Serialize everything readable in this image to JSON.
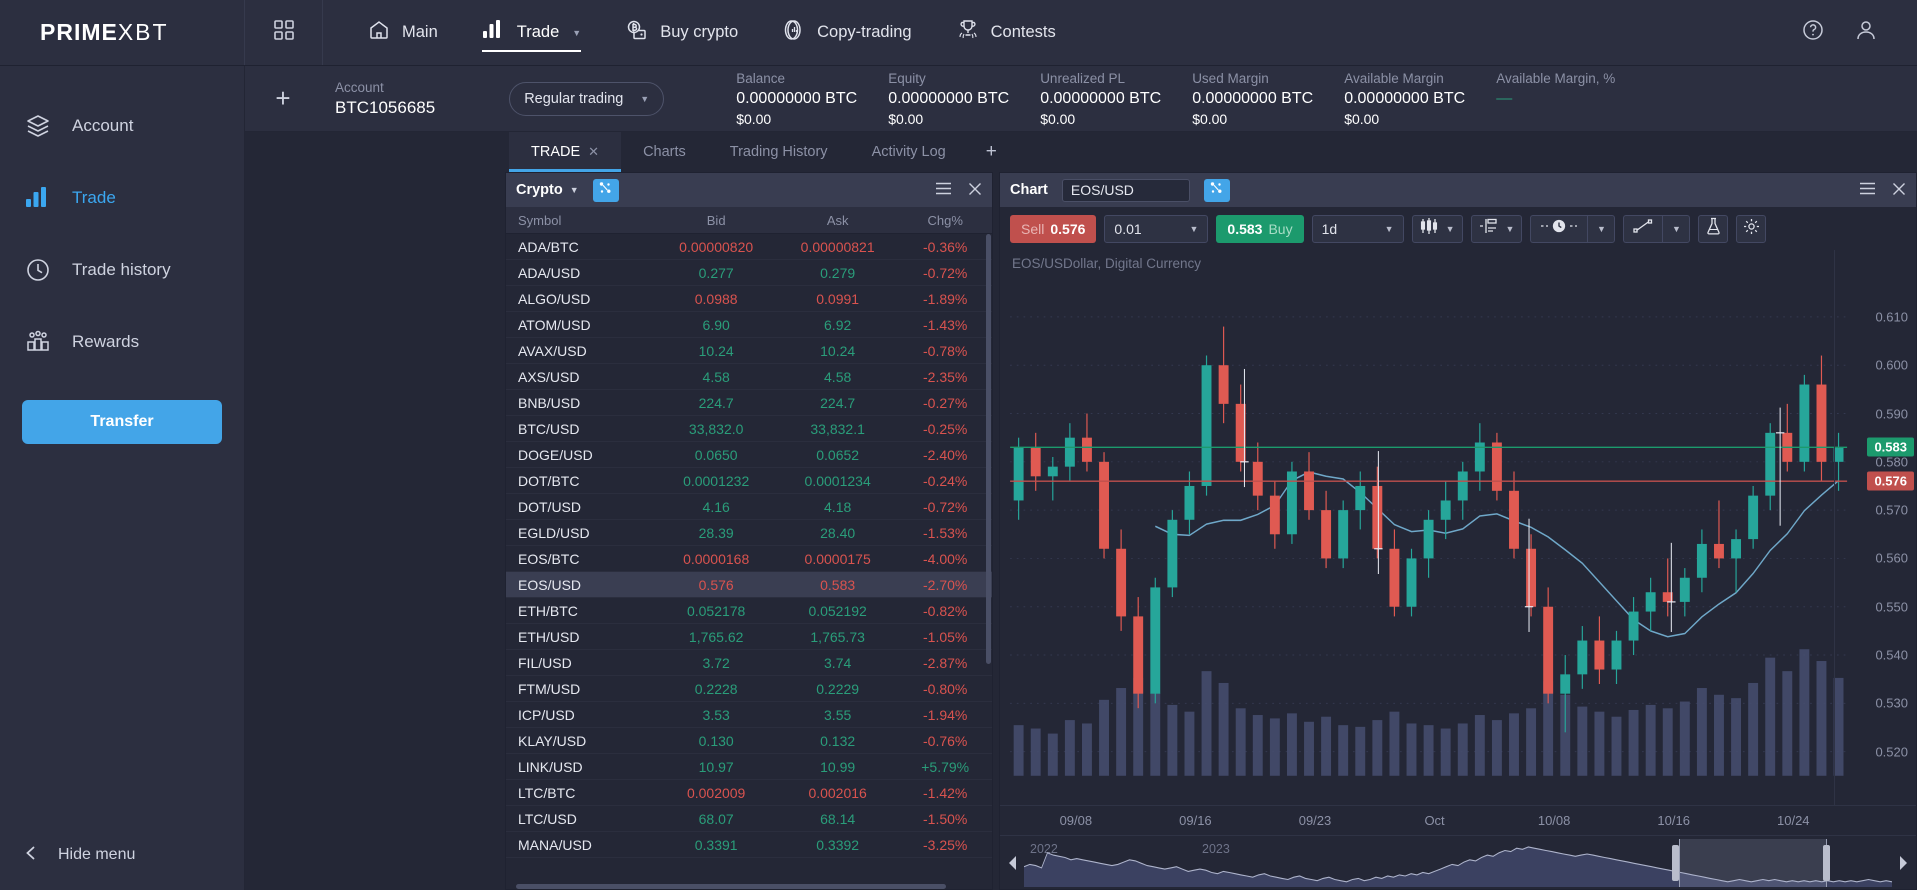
{
  "brand": {
    "prime": "PRIME",
    "xbt": "XBT"
  },
  "topnav": {
    "grid_icon": "grid-icon",
    "items": [
      {
        "label": "Main",
        "icon": "home-icon",
        "active": false,
        "caret": false
      },
      {
        "label": "Trade",
        "icon": "bars-icon",
        "active": true,
        "caret": true
      },
      {
        "label": "Buy crypto",
        "icon": "wallet-bitcoin-icon",
        "active": false,
        "caret": false
      },
      {
        "label": "Copy-trading",
        "icon": "copy-trading-icon",
        "active": false,
        "caret": false
      },
      {
        "label": "Contests",
        "icon": "trophy-icon",
        "active": false,
        "caret": false
      }
    ],
    "help_icon": "question-circle-icon",
    "profile_icon": "user-icon"
  },
  "sidebar": {
    "items": [
      {
        "label": "Account",
        "icon": "layers-icon",
        "active": false
      },
      {
        "label": "Trade",
        "icon": "bar-chart-icon",
        "active": true
      },
      {
        "label": "Trade history",
        "icon": "clock-icon",
        "active": false
      },
      {
        "label": "Rewards",
        "icon": "people-icon",
        "active": false
      }
    ],
    "transfer_label": "Transfer",
    "hide_menu_label": "Hide menu",
    "hide_menu_icon": "chevron-left-icon"
  },
  "account_strip": {
    "add_icon": "plus-icon",
    "account_label": "Account",
    "account_value": "BTC1056685",
    "mode": "Regular trading",
    "stats": [
      {
        "label": "Balance",
        "value": "0.00000000 BTC",
        "sub": "$0.00"
      },
      {
        "label": "Equity",
        "value": "0.00000000 BTC",
        "sub": "$0.00"
      },
      {
        "label": "Unrealized PL",
        "value": "0.00000000 BTC",
        "sub": "$0.00"
      },
      {
        "label": "Used Margin",
        "value": "0.00000000 BTC",
        "sub": "$0.00"
      },
      {
        "label": "Available Margin",
        "value": "0.00000000 BTC",
        "sub": "$0.00"
      },
      {
        "label": "Available Margin, %",
        "value": "—",
        "sub": ""
      }
    ]
  },
  "tabs": {
    "items": [
      {
        "label": "TRADE",
        "active": true,
        "closable": true
      },
      {
        "label": "Charts",
        "active": false,
        "closable": false
      },
      {
        "label": "Trading History",
        "active": false,
        "closable": false
      },
      {
        "label": "Activity Log",
        "active": false,
        "closable": false
      }
    ],
    "add_label": "+"
  },
  "crypto_panel": {
    "title": "Crypto",
    "filter_icon": "assets-icon",
    "menu_icon": "hamburger-icon",
    "close_icon": "close-icon",
    "columns": [
      "Symbol",
      "Bid",
      "Ask",
      "Chg%"
    ],
    "rows": [
      {
        "symbol": "ADA/BTC",
        "bid": "0.00000820",
        "ask": "0.00000821",
        "chg": "-0.36%",
        "bid_dir": "down",
        "ask_dir": "down",
        "chg_dir": "down",
        "selected": false
      },
      {
        "symbol": "ADA/USD",
        "bid": "0.277",
        "ask": "0.279",
        "chg": "-0.72%",
        "bid_dir": "up",
        "ask_dir": "up",
        "chg_dir": "down",
        "selected": false
      },
      {
        "symbol": "ALGO/USD",
        "bid": "0.0988",
        "ask": "0.0991",
        "chg": "-1.89%",
        "bid_dir": "down",
        "ask_dir": "down",
        "chg_dir": "down",
        "selected": false
      },
      {
        "symbol": "ATOM/USD",
        "bid": "6.90",
        "ask": "6.92",
        "chg": "-1.43%",
        "bid_dir": "up",
        "ask_dir": "up",
        "chg_dir": "down",
        "selected": false
      },
      {
        "symbol": "AVAX/USD",
        "bid": "10.24",
        "ask": "10.24",
        "chg": "-0.78%",
        "bid_dir": "up",
        "ask_dir": "up",
        "chg_dir": "down",
        "selected": false
      },
      {
        "symbol": "AXS/USD",
        "bid": "4.58",
        "ask": "4.58",
        "chg": "-2.35%",
        "bid_dir": "up",
        "ask_dir": "up",
        "chg_dir": "down",
        "selected": false
      },
      {
        "symbol": "BNB/USD",
        "bid": "224.7",
        "ask": "224.7",
        "chg": "-0.27%",
        "bid_dir": "up",
        "ask_dir": "up",
        "chg_dir": "down",
        "selected": false
      },
      {
        "symbol": "BTC/USD",
        "bid": "33,832.0",
        "ask": "33,832.1",
        "chg": "-0.25%",
        "bid_dir": "up",
        "ask_dir": "up",
        "chg_dir": "down",
        "selected": false
      },
      {
        "symbol": "DOGE/USD",
        "bid": "0.0650",
        "ask": "0.0652",
        "chg": "-2.40%",
        "bid_dir": "up",
        "ask_dir": "up",
        "chg_dir": "down",
        "selected": false
      },
      {
        "symbol": "DOT/BTC",
        "bid": "0.0001232",
        "ask": "0.0001234",
        "chg": "-0.24%",
        "bid_dir": "up",
        "ask_dir": "up",
        "chg_dir": "down",
        "selected": false
      },
      {
        "symbol": "DOT/USD",
        "bid": "4.16",
        "ask": "4.18",
        "chg": "-0.72%",
        "bid_dir": "up",
        "ask_dir": "up",
        "chg_dir": "down",
        "selected": false
      },
      {
        "symbol": "EGLD/USD",
        "bid": "28.39",
        "ask": "28.40",
        "chg": "-1.53%",
        "bid_dir": "up",
        "ask_dir": "up",
        "chg_dir": "down",
        "selected": false
      },
      {
        "symbol": "EOS/BTC",
        "bid": "0.0000168",
        "ask": "0.0000175",
        "chg": "-4.00%",
        "bid_dir": "down",
        "ask_dir": "down",
        "chg_dir": "down",
        "selected": false
      },
      {
        "symbol": "EOS/USD",
        "bid": "0.576",
        "ask": "0.583",
        "chg": "-2.70%",
        "bid_dir": "down",
        "ask_dir": "down",
        "chg_dir": "down",
        "selected": true
      },
      {
        "symbol": "ETH/BTC",
        "bid": "0.052178",
        "ask": "0.052192",
        "chg": "-0.82%",
        "bid_dir": "up",
        "ask_dir": "up",
        "chg_dir": "down",
        "selected": false
      },
      {
        "symbol": "ETH/USD",
        "bid": "1,765.62",
        "ask": "1,765.73",
        "chg": "-1.05%",
        "bid_dir": "up",
        "ask_dir": "up",
        "chg_dir": "down",
        "selected": false
      },
      {
        "symbol": "FIL/USD",
        "bid": "3.72",
        "ask": "3.74",
        "chg": "-2.87%",
        "bid_dir": "up",
        "ask_dir": "up",
        "chg_dir": "down",
        "selected": false
      },
      {
        "symbol": "FTM/USD",
        "bid": "0.2228",
        "ask": "0.2229",
        "chg": "-0.80%",
        "bid_dir": "up",
        "ask_dir": "up",
        "chg_dir": "down",
        "selected": false
      },
      {
        "symbol": "ICP/USD",
        "bid": "3.53",
        "ask": "3.55",
        "chg": "-1.94%",
        "bid_dir": "up",
        "ask_dir": "up",
        "chg_dir": "down",
        "selected": false
      },
      {
        "symbol": "KLAY/USD",
        "bid": "0.130",
        "ask": "0.132",
        "chg": "-0.76%",
        "bid_dir": "up",
        "ask_dir": "up",
        "chg_dir": "down",
        "selected": false
      },
      {
        "symbol": "LINK/USD",
        "bid": "10.97",
        "ask": "10.99",
        "chg": "+5.79%",
        "bid_dir": "up",
        "ask_dir": "up",
        "chg_dir": "up",
        "selected": false
      },
      {
        "symbol": "LTC/BTC",
        "bid": "0.002009",
        "ask": "0.002016",
        "chg": "-1.42%",
        "bid_dir": "down",
        "ask_dir": "down",
        "chg_dir": "down",
        "selected": false
      },
      {
        "symbol": "LTC/USD",
        "bid": "68.07",
        "ask": "68.14",
        "chg": "-1.50%",
        "bid_dir": "up",
        "ask_dir": "up",
        "chg_dir": "down",
        "selected": false
      },
      {
        "symbol": "MANA/USD",
        "bid": "0.3391",
        "ask": "0.3392",
        "chg": "-3.25%",
        "bid_dir": "up",
        "ask_dir": "up",
        "chg_dir": "down",
        "selected": false
      }
    ]
  },
  "chart_panel": {
    "title": "Chart",
    "symbol": "EOS/USD",
    "filter_icon": "assets-icon",
    "menu_icon": "hamburger-icon",
    "close_icon": "close-icon",
    "sell_label": "Sell",
    "sell_price": "0.576",
    "buy_label": "Buy",
    "buy_price": "0.583",
    "quantity": "0.01",
    "timeframe": "1d",
    "tool_candles_icon": "candlestick-icon",
    "tool_indicators_icon": "indicators-icon",
    "tool_clock_icon": "time-icon",
    "tool_line_icon": "trendline-icon",
    "tool_flask_icon": "flask-icon",
    "tool_gear_icon": "gear-icon",
    "subtitle": "EOS/USDollar, Digital Currency"
  },
  "chart_data": {
    "type": "candlestick",
    "title": "EOS/USDollar, Digital Currency",
    "symbol": "EOS/USD",
    "timeframe": "1d",
    "ylim": [
      0.515,
      0.617
    ],
    "yticks": [
      0.52,
      0.53,
      0.54,
      0.55,
      0.56,
      0.57,
      0.58,
      0.59,
      0.6,
      0.61
    ],
    "xticks": [
      "09/08",
      "09/16",
      "09/23",
      "Oct",
      "10/08",
      "10/16",
      "10/24"
    ],
    "grid": true,
    "legend": "none",
    "price_markers": [
      {
        "value": "0.583",
        "kind": "ask",
        "color": "#1c9a6d"
      },
      {
        "value": "0.576",
        "kind": "bid",
        "color": "#c0504d"
      }
    ],
    "overlays": [
      {
        "name": "moving-average",
        "color": "#6fa8c9"
      },
      {
        "name": "volume",
        "color": "#4a5272"
      }
    ],
    "candles": [
      {
        "o": 0.572,
        "h": 0.585,
        "l": 0.568,
        "c": 0.583,
        "v": 0.3
      },
      {
        "o": 0.583,
        "h": 0.586,
        "l": 0.574,
        "c": 0.577,
        "v": 0.28
      },
      {
        "o": 0.577,
        "h": 0.581,
        "l": 0.572,
        "c": 0.579,
        "v": 0.25
      },
      {
        "o": 0.579,
        "h": 0.588,
        "l": 0.576,
        "c": 0.585,
        "v": 0.33
      },
      {
        "o": 0.585,
        "h": 0.59,
        "l": 0.578,
        "c": 0.58,
        "v": 0.31
      },
      {
        "o": 0.58,
        "h": 0.582,
        "l": 0.56,
        "c": 0.562,
        "v": 0.45
      },
      {
        "o": 0.562,
        "h": 0.566,
        "l": 0.545,
        "c": 0.548,
        "v": 0.52
      },
      {
        "o": 0.548,
        "h": 0.552,
        "l": 0.529,
        "c": 0.532,
        "v": 0.58
      },
      {
        "o": 0.532,
        "h": 0.556,
        "l": 0.53,
        "c": 0.554,
        "v": 0.49
      },
      {
        "o": 0.554,
        "h": 0.57,
        "l": 0.552,
        "c": 0.568,
        "v": 0.42
      },
      {
        "o": 0.568,
        "h": 0.578,
        "l": 0.565,
        "c": 0.575,
        "v": 0.38
      },
      {
        "o": 0.575,
        "h": 0.602,
        "l": 0.573,
        "c": 0.6,
        "v": 0.62
      },
      {
        "o": 0.6,
        "h": 0.608,
        "l": 0.588,
        "c": 0.592,
        "v": 0.55
      },
      {
        "o": 0.592,
        "h": 0.596,
        "l": 0.578,
        "c": 0.58,
        "v": 0.4
      },
      {
        "o": 0.58,
        "h": 0.584,
        "l": 0.57,
        "c": 0.573,
        "v": 0.36
      },
      {
        "o": 0.573,
        "h": 0.576,
        "l": 0.562,
        "c": 0.565,
        "v": 0.34
      },
      {
        "o": 0.565,
        "h": 0.58,
        "l": 0.563,
        "c": 0.578,
        "v": 0.37
      },
      {
        "o": 0.578,
        "h": 0.582,
        "l": 0.568,
        "c": 0.57,
        "v": 0.32
      },
      {
        "o": 0.57,
        "h": 0.574,
        "l": 0.558,
        "c": 0.56,
        "v": 0.35
      },
      {
        "o": 0.56,
        "h": 0.572,
        "l": 0.558,
        "c": 0.57,
        "v": 0.3
      },
      {
        "o": 0.57,
        "h": 0.578,
        "l": 0.566,
        "c": 0.575,
        "v": 0.29
      },
      {
        "o": 0.575,
        "h": 0.579,
        "l": 0.56,
        "c": 0.562,
        "v": 0.33
      },
      {
        "o": 0.562,
        "h": 0.566,
        "l": 0.548,
        "c": 0.55,
        "v": 0.38
      },
      {
        "o": 0.55,
        "h": 0.562,
        "l": 0.548,
        "c": 0.56,
        "v": 0.31
      },
      {
        "o": 0.56,
        "h": 0.57,
        "l": 0.556,
        "c": 0.568,
        "v": 0.3
      },
      {
        "o": 0.568,
        "h": 0.576,
        "l": 0.564,
        "c": 0.572,
        "v": 0.28
      },
      {
        "o": 0.572,
        "h": 0.58,
        "l": 0.568,
        "c": 0.578,
        "v": 0.31
      },
      {
        "o": 0.578,
        "h": 0.588,
        "l": 0.574,
        "c": 0.584,
        "v": 0.36
      },
      {
        "o": 0.584,
        "h": 0.586,
        "l": 0.572,
        "c": 0.574,
        "v": 0.33
      },
      {
        "o": 0.574,
        "h": 0.578,
        "l": 0.56,
        "c": 0.562,
        "v": 0.37
      },
      {
        "o": 0.562,
        "h": 0.565,
        "l": 0.548,
        "c": 0.55,
        "v": 0.4
      },
      {
        "o": 0.55,
        "h": 0.554,
        "l": 0.53,
        "c": 0.532,
        "v": 0.56
      },
      {
        "o": 0.532,
        "h": 0.54,
        "l": 0.524,
        "c": 0.536,
        "v": 0.48
      },
      {
        "o": 0.536,
        "h": 0.546,
        "l": 0.533,
        "c": 0.543,
        "v": 0.41
      },
      {
        "o": 0.543,
        "h": 0.548,
        "l": 0.534,
        "c": 0.537,
        "v": 0.38
      },
      {
        "o": 0.537,
        "h": 0.545,
        "l": 0.534,
        "c": 0.543,
        "v": 0.35
      },
      {
        "o": 0.543,
        "h": 0.552,
        "l": 0.54,
        "c": 0.549,
        "v": 0.39
      },
      {
        "o": 0.549,
        "h": 0.556,
        "l": 0.545,
        "c": 0.553,
        "v": 0.42
      },
      {
        "o": 0.553,
        "h": 0.56,
        "l": 0.548,
        "c": 0.551,
        "v": 0.4
      },
      {
        "o": 0.551,
        "h": 0.558,
        "l": 0.548,
        "c": 0.556,
        "v": 0.44
      },
      {
        "o": 0.556,
        "h": 0.566,
        "l": 0.553,
        "c": 0.563,
        "v": 0.52
      },
      {
        "o": 0.563,
        "h": 0.572,
        "l": 0.558,
        "c": 0.56,
        "v": 0.48
      },
      {
        "o": 0.56,
        "h": 0.566,
        "l": 0.553,
        "c": 0.564,
        "v": 0.46
      },
      {
        "o": 0.564,
        "h": 0.575,
        "l": 0.562,
        "c": 0.573,
        "v": 0.55
      },
      {
        "o": 0.573,
        "h": 0.588,
        "l": 0.57,
        "c": 0.586,
        "v": 0.7
      },
      {
        "o": 0.586,
        "h": 0.592,
        "l": 0.578,
        "c": 0.58,
        "v": 0.62
      },
      {
        "o": 0.58,
        "h": 0.598,
        "l": 0.578,
        "c": 0.596,
        "v": 0.75
      },
      {
        "o": 0.596,
        "h": 0.602,
        "l": 0.576,
        "c": 0.58,
        "v": 0.68
      },
      {
        "o": 0.58,
        "h": 0.586,
        "l": 0.574,
        "c": 0.583,
        "v": 0.58
      }
    ]
  },
  "navigator": {
    "left_arrow": "left-arrow-icon",
    "right_arrow": "right-arrow-icon",
    "years": [
      "2022",
      "2023"
    ]
  }
}
